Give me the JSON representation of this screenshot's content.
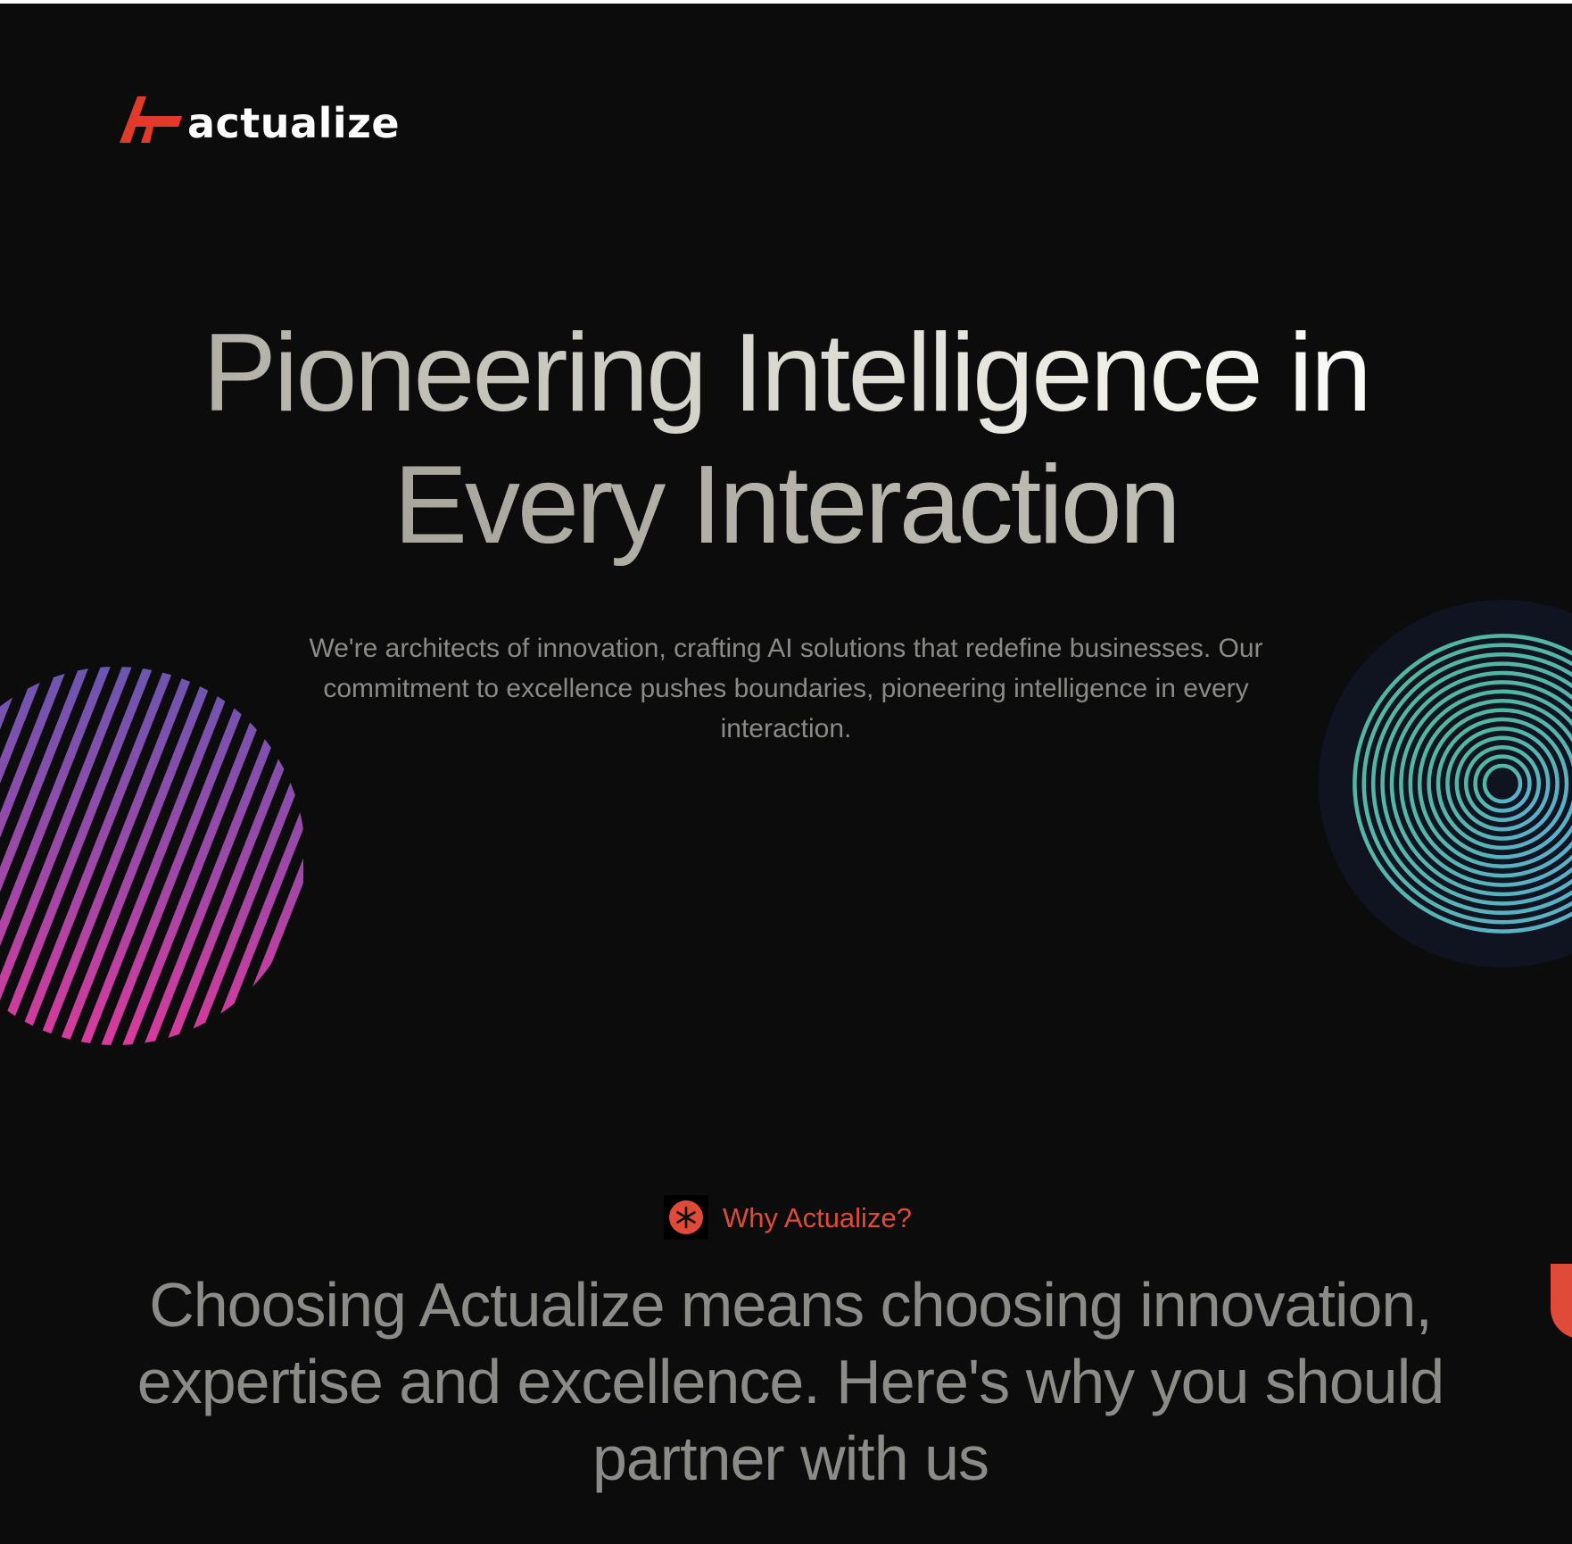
{
  "brand": {
    "name": "actualize",
    "accent_color": "#e04a38"
  },
  "hero": {
    "title_line1": "Pioneering Intelligence in",
    "title_line2": "Every Interaction",
    "subtitle": "We're architects of innovation, crafting AI solutions that redefine businesses. Our commitment to excellence pushes boundaries, pioneering intelligence in every interaction."
  },
  "decorations": {
    "left": {
      "icon": "striped-circle-graphic",
      "colors": [
        "#6b56b0",
        "#d83a9a"
      ]
    },
    "right": {
      "icon": "concentric-rings-graphic",
      "colors": [
        "#4fb89a",
        "#5aaed6"
      ],
      "backdrop": "#0f1420"
    }
  },
  "why_section": {
    "eyebrow": "Why Actualize?",
    "eyebrow_icon": "asterisk-icon",
    "heading": "Choosing Actualize means choosing innovation, expertise and excellence. Here's why you should partner with us"
  }
}
